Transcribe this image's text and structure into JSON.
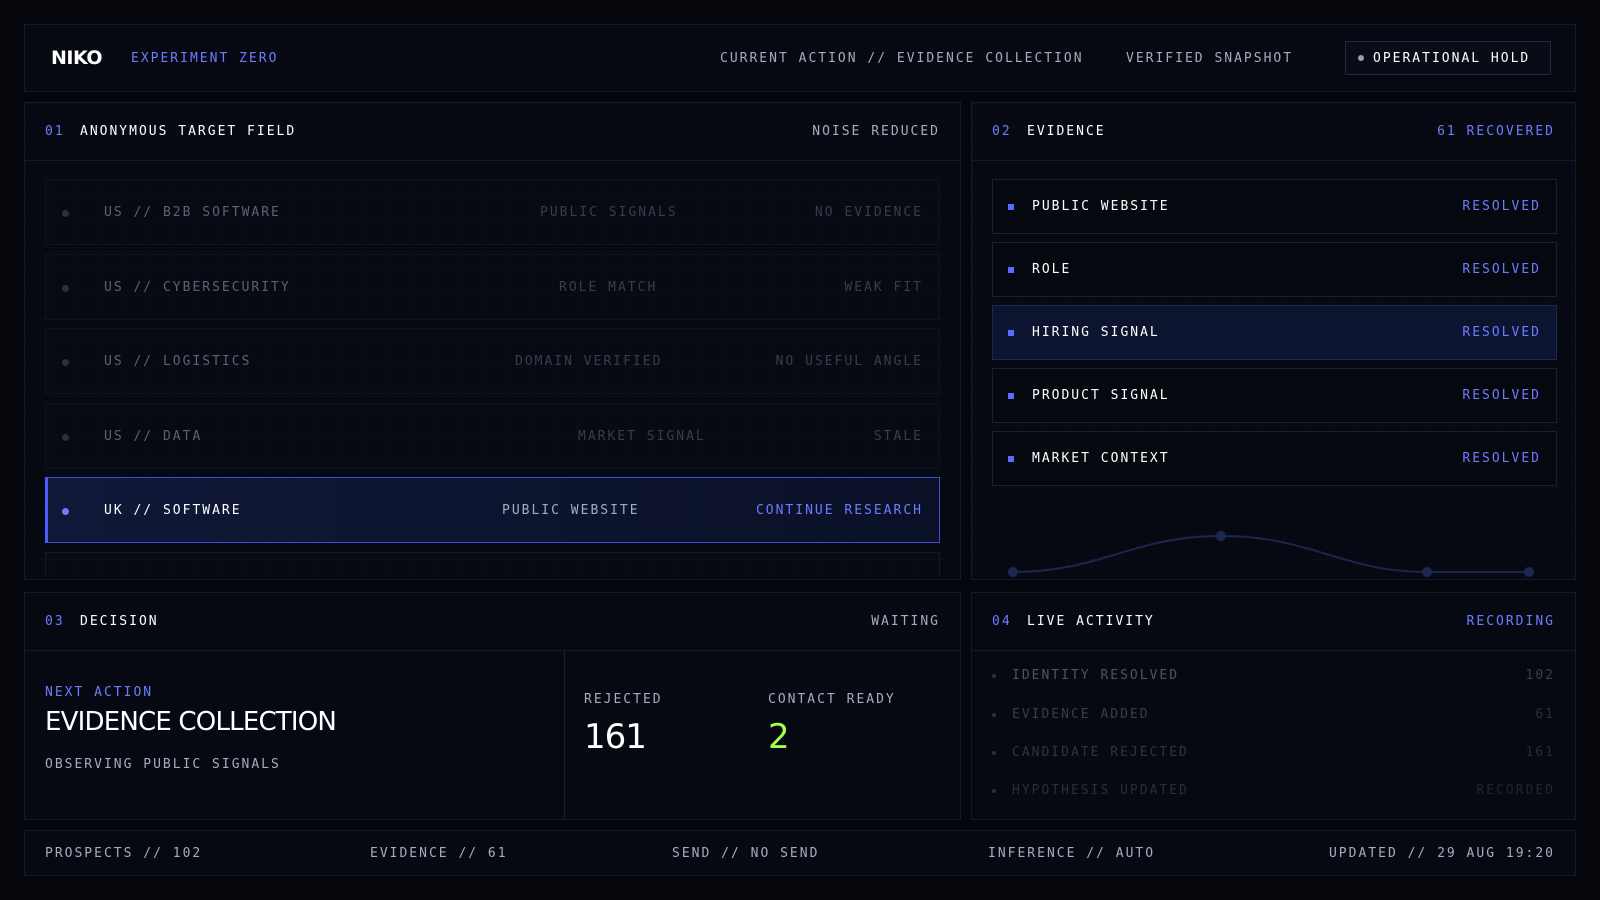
{
  "topbar": {
    "logo": "NIKO",
    "experiment": "EXPERIMENT ZERO",
    "current_action": "CURRENT ACTION // EVIDENCE COLLECTION",
    "snapshot": "VERIFIED SNAPSHOT",
    "hold_label": "OPERATIONAL HOLD"
  },
  "targets": {
    "num": "01",
    "title": "ANONYMOUS TARGET FIELD",
    "status": "NOISE REDUCED",
    "rows": [
      {
        "name": "US // B2B SOFTWARE",
        "signal": "PUBLIC SIGNALS",
        "result": "NO EVIDENCE"
      },
      {
        "name": "US // CYBERSECURITY",
        "signal": "ROLE MATCH",
        "result": "WEAK FIT"
      },
      {
        "name": "US // LOGISTICS",
        "signal": "DOMAIN VERIFIED",
        "result": "NO USEFUL ANGLE"
      },
      {
        "name": "US // DATA",
        "signal": "MARKET SIGNAL",
        "result": "STALE"
      },
      {
        "name": "UK // SOFTWARE",
        "signal": "PUBLIC WEBSITE",
        "result": "CONTINUE RESEARCH"
      }
    ]
  },
  "evidence": {
    "num": "02",
    "title": "EVIDENCE",
    "status": "61 RECOVERED",
    "items": [
      {
        "label": "PUBLIC WEBSITE",
        "status": "RESOLVED"
      },
      {
        "label": "ROLE",
        "status": "RESOLVED"
      },
      {
        "label": "HIRING SIGNAL",
        "status": "RESOLVED"
      },
      {
        "label": "PRODUCT SIGNAL",
        "status": "RESOLVED"
      },
      {
        "label": "MARKET CONTEXT",
        "status": "RESOLVED"
      }
    ]
  },
  "decision": {
    "num": "03",
    "title": "DECISION",
    "status": "WAITING",
    "next_label": "NEXT ACTION",
    "next_value": "EVIDENCE COLLECTION",
    "next_sub": "OBSERVING PUBLIC SIGNALS",
    "rejected_label": "REJECTED",
    "rejected_value": "161",
    "contact_label": "CONTACT READY",
    "contact_value": "2"
  },
  "activity": {
    "num": "04",
    "title": "LIVE ACTIVITY",
    "status": "RECORDING",
    "items": [
      {
        "label": "IDENTITY RESOLVED",
        "value": "102"
      },
      {
        "label": "EVIDENCE ADDED",
        "value": "61"
      },
      {
        "label": "CANDIDATE REJECTED",
        "value": "161"
      },
      {
        "label": "HYPOTHESIS UPDATED",
        "value": "RECORDED"
      }
    ]
  },
  "footer": {
    "prospects": "PROSPECTS // 102",
    "evidence": "EVIDENCE // 61",
    "send": "SEND // NO SEND",
    "inference": "INFERENCE // AUTO",
    "updated": "UPDATED // 29 AUG 19:20"
  },
  "colors": {
    "accent": "#6d7cff",
    "success": "#a4ff4a",
    "background": "#04060c"
  }
}
